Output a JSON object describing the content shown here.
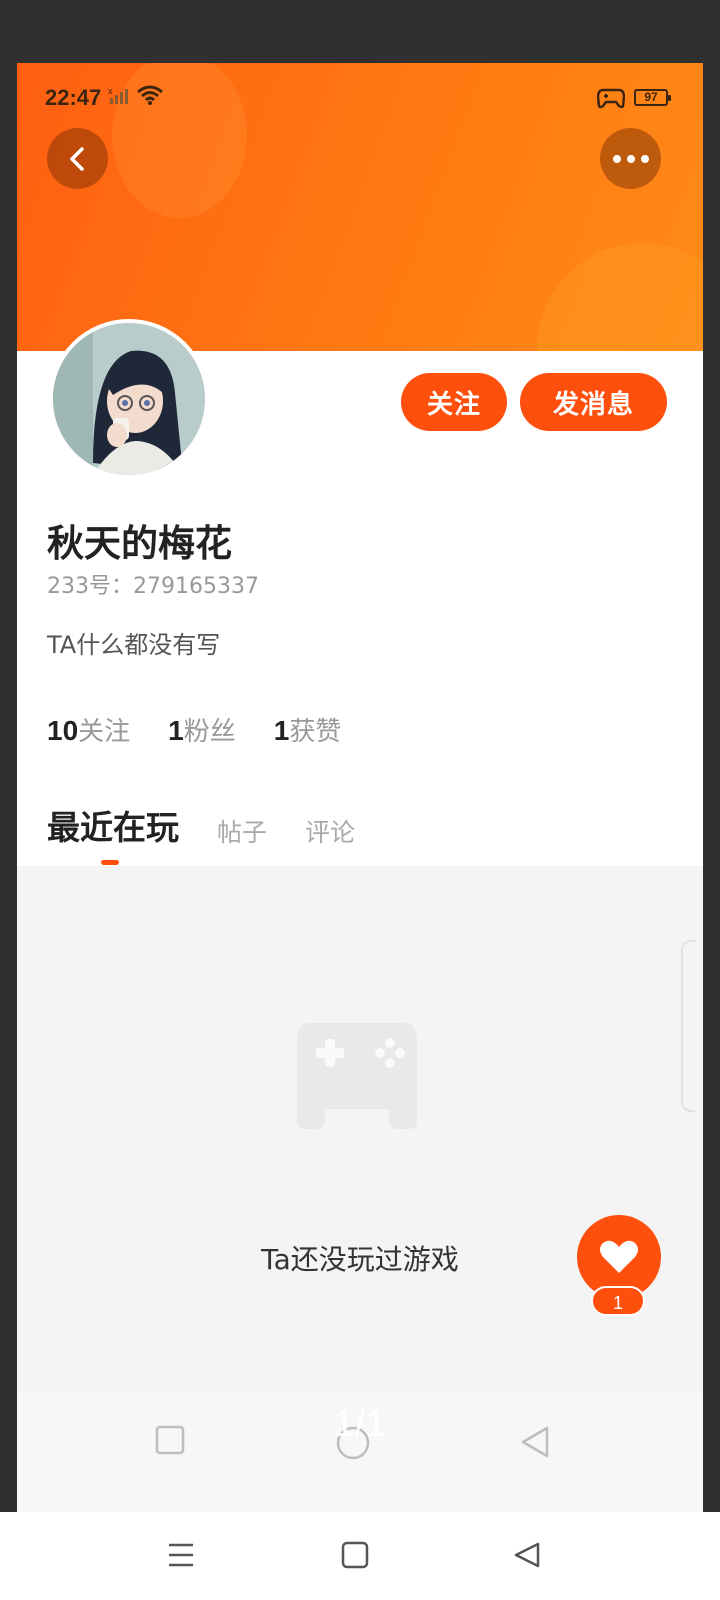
{
  "status_bar": {
    "time": "22:47",
    "battery": "97"
  },
  "header": {
    "back_icon": "chevron-left-icon",
    "more_icon": "more-horizontal-icon"
  },
  "profile": {
    "name": "秋天的梅花",
    "id_text": "233号：279165337",
    "bio": "TA什么都没有写",
    "follow_label": "关注",
    "message_label": "发消息",
    "stats": [
      {
        "num": "10",
        "label": "关注"
      },
      {
        "num": "1",
        "label": "粉丝"
      },
      {
        "num": "1",
        "label": "获赞"
      }
    ]
  },
  "tabs": [
    {
      "label": "最近在玩",
      "active": true
    },
    {
      "label": "帖子",
      "active": false
    },
    {
      "label": "评论",
      "active": false
    }
  ],
  "empty_state": {
    "icon": "gamepad-icon",
    "text": "Ta还没玩过游戏"
  },
  "like_fab": {
    "icon": "heart-icon",
    "count": "1"
  },
  "page_indicator": "1/1",
  "colors": {
    "accent": "#ff4f0c",
    "banner_start": "#ff5f12",
    "banner_end": "#ff8a18"
  }
}
